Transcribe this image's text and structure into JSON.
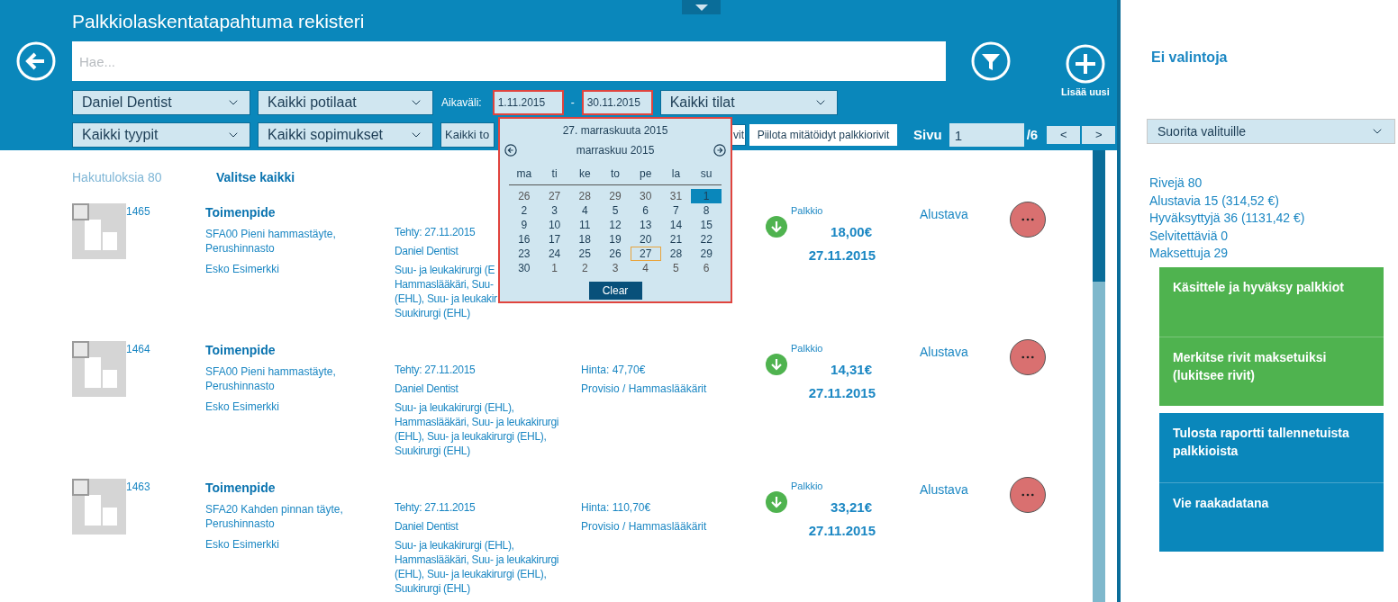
{
  "header": {
    "title": "Palkkiolaskentatapahtuma rekisteri",
    "search": {
      "placeholder": "Hae..."
    },
    "add_label": "Lisää uusi"
  },
  "filters": {
    "dentist": "Daniel Dentist",
    "patients": "Kaikki potilaat",
    "range_label": "Aikaväli:",
    "date_from": "1.11.2015",
    "range_separator": "-",
    "date_to": "30.11.2015",
    "states": "Kaikki tilat",
    "types": "Kaikki tyypit",
    "contracts": "Kaikki sopimukset",
    "column_3": "Kaikki to",
    "partial_button": "vit",
    "hide_void_button": "Piilota mitätöidyt palkkiorivit"
  },
  "pager": {
    "label": "Sivu",
    "page": "1",
    "total": "/6",
    "prev": "<",
    "next": ">"
  },
  "calendar": {
    "heading": "27. marraskuuta 2015",
    "month": "marraskuu 2015",
    "weekdays": [
      "ma",
      "ti",
      "ke",
      "to",
      "pe",
      "la",
      "su"
    ],
    "days": [
      {
        "label": "26",
        "outside": true,
        "selected": false,
        "today": false
      },
      {
        "label": "27",
        "outside": true,
        "selected": false,
        "today": false
      },
      {
        "label": "28",
        "outside": true,
        "selected": false,
        "today": false
      },
      {
        "label": "29",
        "outside": true,
        "selected": false,
        "today": false
      },
      {
        "label": "30",
        "outside": true,
        "selected": false,
        "today": false
      },
      {
        "label": "31",
        "outside": true,
        "selected": false,
        "today": false
      },
      {
        "label": "1",
        "outside": false,
        "selected": true,
        "today": false
      },
      {
        "label": "2",
        "outside": false,
        "selected": false,
        "today": false
      },
      {
        "label": "3",
        "outside": false,
        "selected": false,
        "today": false
      },
      {
        "label": "4",
        "outside": false,
        "selected": false,
        "today": false
      },
      {
        "label": "5",
        "outside": false,
        "selected": false,
        "today": false
      },
      {
        "label": "6",
        "outside": false,
        "selected": false,
        "today": false
      },
      {
        "label": "7",
        "outside": false,
        "selected": false,
        "today": false
      },
      {
        "label": "8",
        "outside": false,
        "selected": false,
        "today": false
      },
      {
        "label": "9",
        "outside": false,
        "selected": false,
        "today": false
      },
      {
        "label": "10",
        "outside": false,
        "selected": false,
        "today": false
      },
      {
        "label": "11",
        "outside": false,
        "selected": false,
        "today": false
      },
      {
        "label": "12",
        "outside": false,
        "selected": false,
        "today": false
      },
      {
        "label": "13",
        "outside": false,
        "selected": false,
        "today": false
      },
      {
        "label": "14",
        "outside": false,
        "selected": false,
        "today": false
      },
      {
        "label": "15",
        "outside": false,
        "selected": false,
        "today": false
      },
      {
        "label": "16",
        "outside": false,
        "selected": false,
        "today": false
      },
      {
        "label": "17",
        "outside": false,
        "selected": false,
        "today": false
      },
      {
        "label": "18",
        "outside": false,
        "selected": false,
        "today": false
      },
      {
        "label": "19",
        "outside": false,
        "selected": false,
        "today": false
      },
      {
        "label": "20",
        "outside": false,
        "selected": false,
        "today": false
      },
      {
        "label": "21",
        "outside": false,
        "selected": false,
        "today": false
      },
      {
        "label": "22",
        "outside": false,
        "selected": false,
        "today": false
      },
      {
        "label": "23",
        "outside": false,
        "selected": false,
        "today": false
      },
      {
        "label": "24",
        "outside": false,
        "selected": false,
        "today": false
      },
      {
        "label": "25",
        "outside": false,
        "selected": false,
        "today": false
      },
      {
        "label": "26",
        "outside": false,
        "selected": false,
        "today": false
      },
      {
        "label": "27",
        "outside": false,
        "selected": false,
        "today": true
      },
      {
        "label": "28",
        "outside": false,
        "selected": false,
        "today": false
      },
      {
        "label": "29",
        "outside": false,
        "selected": false,
        "today": false
      },
      {
        "label": "30",
        "outside": false,
        "selected": false,
        "today": false
      },
      {
        "label": "1",
        "outside": true,
        "selected": false,
        "today": false
      },
      {
        "label": "2",
        "outside": true,
        "selected": false,
        "today": false
      },
      {
        "label": "3",
        "outside": true,
        "selected": false,
        "today": false
      },
      {
        "label": "4",
        "outside": true,
        "selected": false,
        "today": false
      },
      {
        "label": "5",
        "outside": true,
        "selected": false,
        "today": false
      },
      {
        "label": "6",
        "outside": true,
        "selected": false,
        "today": false
      }
    ],
    "clear": "Clear"
  },
  "results": {
    "count": "Hakutuloksia 80",
    "select_all": "Valitse kaikki",
    "rows": [
      {
        "checked": false,
        "id": "1465",
        "title": "Toimenpide",
        "service": "SFA00 Pieni hammastäyte, Perushinnasto",
        "patient": "Esko Esimerkki",
        "done": "Tehty: 27.11.2015",
        "dentist": "Daniel Dentist",
        "specialty_lines": [
          "Suu- ja leukakirurgi (E",
          "Hammaslääkäri, Suu-",
          "(EHL), Suu- ja leukakir",
          "Suukirurgi (EHL)"
        ],
        "type": "Palkkio",
        "amount": "18,00€",
        "date": "27.11.2015",
        "status": "Alustava"
      },
      {
        "checked": false,
        "id": "1464",
        "title": "Toimenpide",
        "service": "SFA00 Pieni hammastäyte, Perushinnasto",
        "patient": "Esko Esimerkki",
        "done": "Tehty: 27.11.2015",
        "dentist": "Daniel Dentist",
        "specialty_lines": [
          "Suu- ja leukakirurgi (EHL),",
          "Hammaslääkäri, Suu- ja leukakirurgi",
          "(EHL), Suu- ja leukakirurgi (EHL),",
          "Suukirurgi (EHL)"
        ],
        "price": "Hinta: 47,70€",
        "contract": "Provisio / Hammaslääkärit",
        "type": "Palkkio",
        "amount": "14,31€",
        "date": "27.11.2015",
        "status": "Alustava"
      },
      {
        "checked": false,
        "id": "1463",
        "title": "Toimenpide",
        "service": "SFA20 Kahden pinnan täyte, Perushinnasto",
        "patient": "Esko Esimerkki",
        "done": "Tehty: 27.11.2015",
        "dentist": "Daniel Dentist",
        "specialty_lines": [
          "Suu- ja leukakirurgi (EHL),",
          "Hammaslääkäri, Suu- ja leukakirurgi",
          "(EHL), Suu- ja leukakirurgi (EHL),",
          "Suukirurgi (EHL)"
        ],
        "price": "Hinta: 110,70€",
        "contract": "Provisio / Hammaslääkärit",
        "type": "Palkkio",
        "amount": "33,21€",
        "date": "27.11.2015",
        "status": "Alustava"
      }
    ]
  },
  "sidebar": {
    "title": "Ei valintoja",
    "bulk_action": "Suorita valituille",
    "stats": [
      "Rivejä 80",
      "Alustavia 15 (314,52 €)",
      "Hyväksyttyjä 36 (1131,42 €)",
      "Selvitettäviä 0",
      "Maksettuja 29"
    ],
    "action_groups": [
      {
        "color": "#4fb34f",
        "actions": [
          "Käsittele ja hyväksy palkkiot",
          "Merkitse rivit maksetuiksi (lukitsee rivit)"
        ]
      },
      {
        "color": "#0a87bb",
        "actions": [
          "Tulosta raportti tallennetuista palkkioista",
          "Vie raakadatana"
        ]
      }
    ]
  }
}
